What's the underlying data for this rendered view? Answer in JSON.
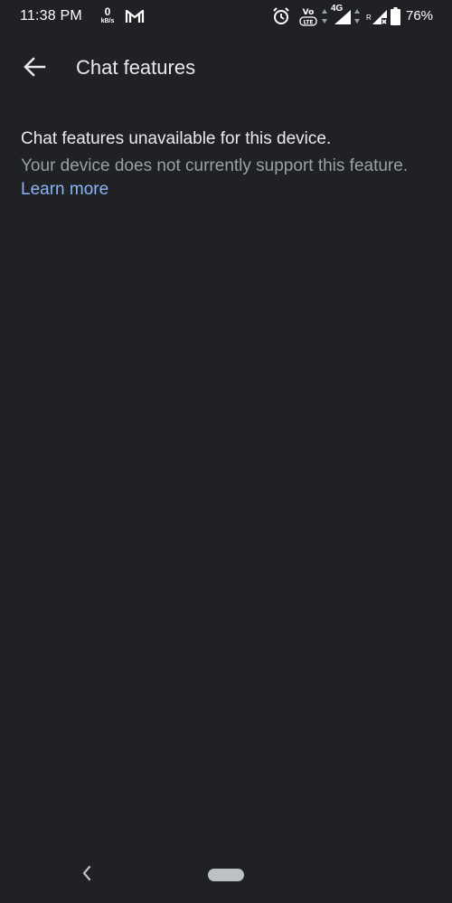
{
  "status_bar": {
    "time": "11:38 PM",
    "data_speed_value": "0",
    "data_speed_unit": "kB/s",
    "network_type": "4G",
    "roaming_indicator": "R",
    "battery_percent": "76%"
  },
  "app_bar": {
    "title": "Chat features"
  },
  "content": {
    "primary_text": "Chat features unavailable for this device.",
    "secondary_text": "Your device does not currently support this feature.",
    "link_text": "Learn more"
  },
  "icons": {
    "back": "arrow-back-icon",
    "gmail": "gmail-icon",
    "alarm": "alarm-icon",
    "volte": "volte-icon",
    "signal": "signal-icon",
    "battery": "battery-icon",
    "nav_back": "nav-back-icon",
    "nav_home": "home-pill"
  },
  "colors": {
    "background": "#202124",
    "primary_text": "#e8eaed",
    "secondary_text": "#9aa0a6",
    "link": "#8ab4f8"
  }
}
